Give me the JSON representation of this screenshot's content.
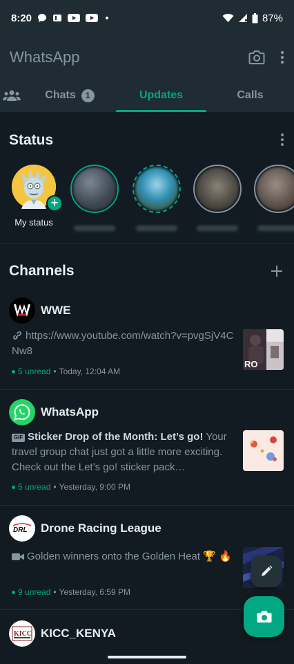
{
  "status_bar": {
    "time": "8:20",
    "battery": "87%"
  },
  "app": {
    "title": "WhatsApp"
  },
  "tabs": {
    "chats": {
      "label": "Chats",
      "badge": "1"
    },
    "updates": {
      "label": "Updates"
    },
    "calls": {
      "label": "Calls"
    }
  },
  "status": {
    "title": "Status",
    "my_status_label": "My status"
  },
  "channels": {
    "title": "Channels",
    "items": [
      {
        "name": "WWE",
        "message": "https://www.youtube.com/watch?v=pvgSjV4CNw8",
        "unread": "5 unread",
        "time": "Today, 12:04 AM"
      },
      {
        "name": "WhatsApp",
        "message_bold": "Sticker Drop of the Month: Let’s go!",
        "message": " Your travel group chat just got a little more exciting. Check out the Let’s go! sticker pack…",
        "unread": "5 unread",
        "time": "Yesterday, 9:00 PM"
      },
      {
        "name": "Drone Racing League",
        "message": "Golden winners onto the Golden Heat 🏆 🔥",
        "unread": "9 unread",
        "time": "Yesterday, 6:59 PM"
      },
      {
        "name": "KICC_KENYA"
      }
    ]
  },
  "colors": {
    "accent": "#00a884",
    "background": "#121b22",
    "bar": "#1f2c34"
  }
}
